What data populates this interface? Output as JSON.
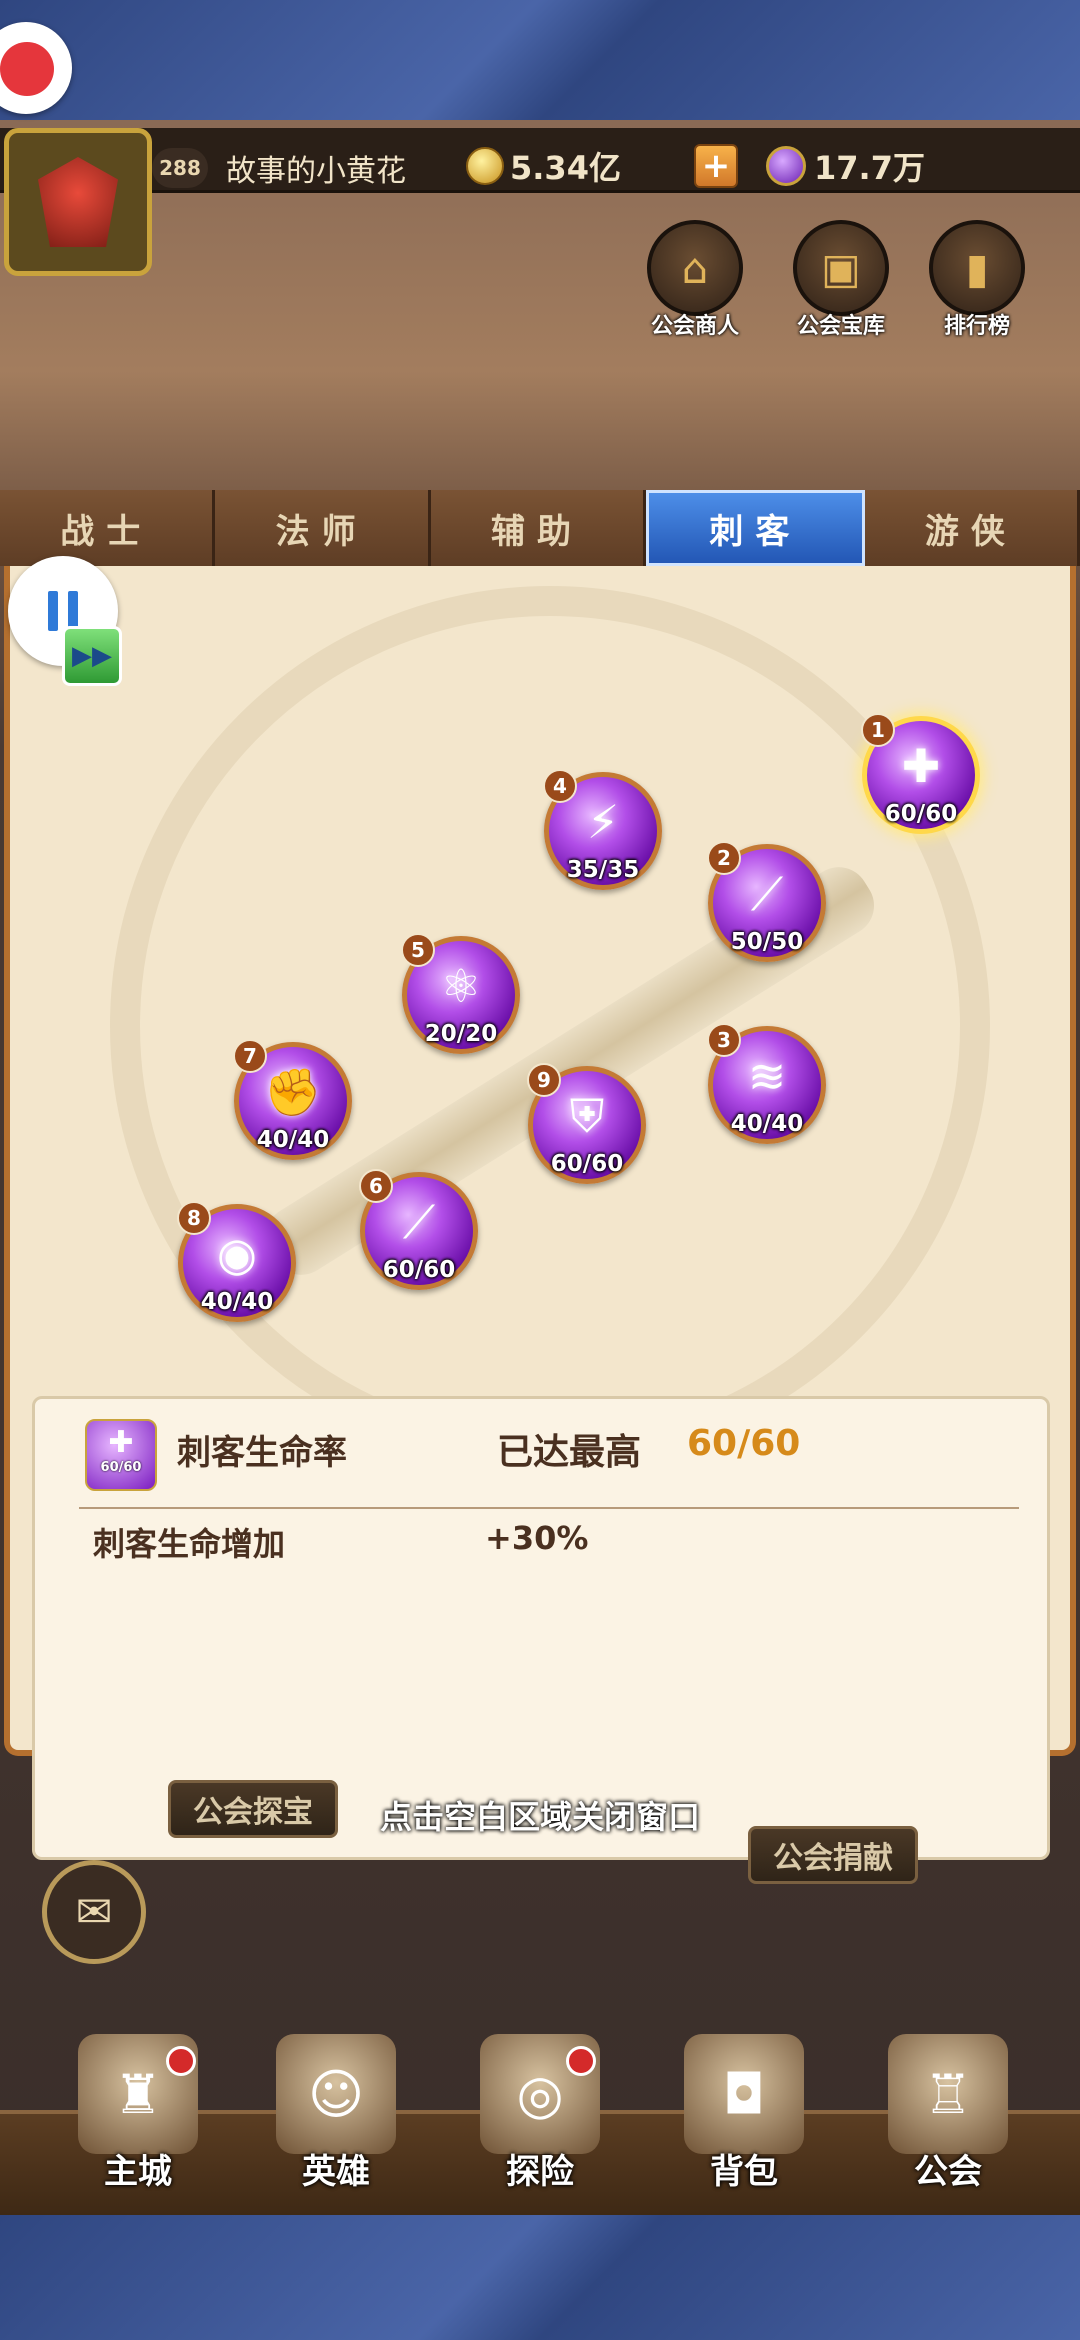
{
  "player": {
    "level": "288",
    "name": "故事的小黄花",
    "gold": "5.34亿",
    "gems": "17.7万"
  },
  "guild_buttons": [
    {
      "label": "公会商人",
      "icon": "shop-icon"
    },
    {
      "label": "公会宝库",
      "icon": "chest-icon"
    },
    {
      "label": "排行榜",
      "icon": "ranking-icon"
    }
  ],
  "tabs": [
    {
      "label": "战士",
      "active": false
    },
    {
      "label": "法师",
      "active": false
    },
    {
      "label": "辅助",
      "active": false
    },
    {
      "label": "刺客",
      "active": true
    },
    {
      "label": "游侠",
      "active": false
    }
  ],
  "skill_nodes": [
    {
      "num": "1",
      "progress": "60/60",
      "icon": "shield-plus-icon",
      "selected": true
    },
    {
      "num": "2",
      "progress": "50/50",
      "icon": "slash-icon"
    },
    {
      "num": "3",
      "progress": "40/40",
      "icon": "claw-icon"
    },
    {
      "num": "4",
      "progress": "35/35",
      "icon": "lightning-icon"
    },
    {
      "num": "5",
      "progress": "20/20",
      "icon": "atom-icon"
    },
    {
      "num": "6",
      "progress": "60/60",
      "icon": "blade-icon"
    },
    {
      "num": "7",
      "progress": "40/40",
      "icon": "fist-icon"
    },
    {
      "num": "8",
      "progress": "40/40",
      "icon": "eye-icon"
    },
    {
      "num": "9",
      "progress": "60/60",
      "icon": "armor-icon"
    }
  ],
  "detail": {
    "icon_progress": "60/60",
    "name": "刺客生命率",
    "status": "已达最高",
    "value": "60/60",
    "effect": "刺客生命增加",
    "bonus": "+30%"
  },
  "close_hint": "点击空白区域关闭窗口",
  "plaques": {
    "left": "公会探宝",
    "right": "公会捐献"
  },
  "nav": [
    {
      "label": "主城",
      "icon": "castle-icon",
      "badge": true
    },
    {
      "label": "英雄",
      "icon": "hero-icon",
      "badge": false
    },
    {
      "label": "探险",
      "icon": "portal-icon",
      "badge": true
    },
    {
      "label": "背包",
      "icon": "backpack-icon",
      "badge": false
    },
    {
      "label": "公会",
      "icon": "guild-tower-icon",
      "badge": false
    }
  ],
  "colors": {
    "active_tab": "#2f6fd0",
    "skill_purple": "#9b2fd6",
    "max_value": "#d68a1a"
  }
}
